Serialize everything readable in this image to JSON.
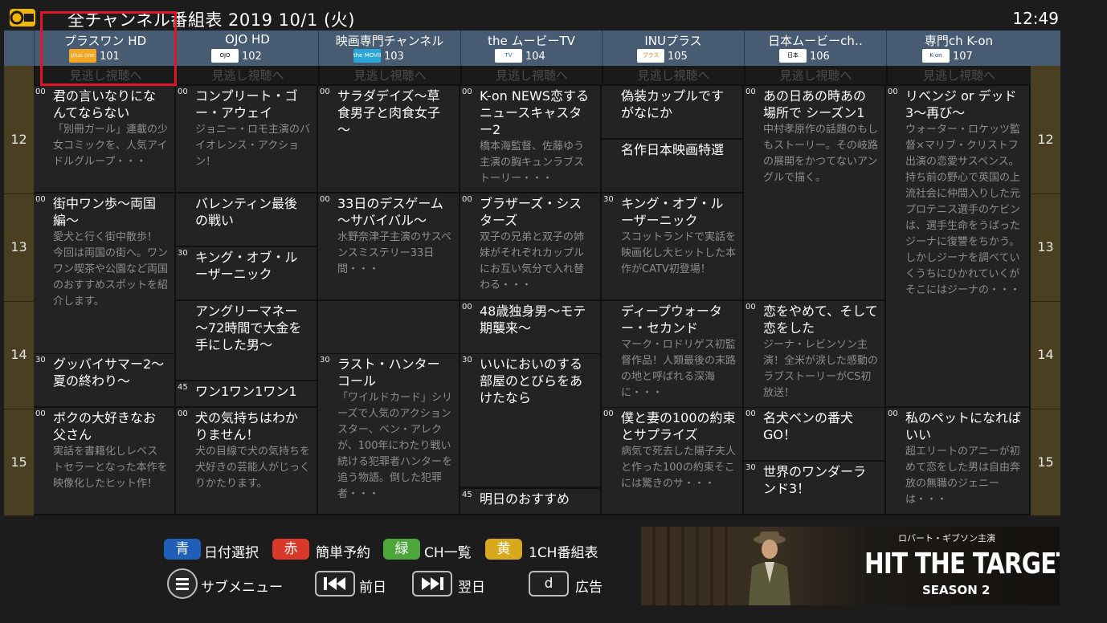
{
  "header": {
    "title": "全チャンネル番組表 2019 10/1 (火)",
    "clock": "12:49",
    "logo_text": "G GUIDE"
  },
  "missed_label": "見逃し視聴へ",
  "hours": [
    "12",
    "13",
    "14",
    "15"
  ],
  "channels": [
    {
      "name": "プラスワン HD",
      "num": "101",
      "logo": "plus one",
      "logo_bg": "#f5a623",
      "logo_fg": "#ffffff"
    },
    {
      "name": "OJO HD",
      "num": "102",
      "logo": "OJO",
      "logo_bg": "#ffffff",
      "logo_fg": "#000000"
    },
    {
      "name": "映画専門チャンネル",
      "num": "103",
      "logo": "the MOVIE",
      "logo_bg": "#2aa6d8",
      "logo_fg": "#ffffff"
    },
    {
      "name": "the ムービーTV",
      "num": "104",
      "logo": "TV",
      "logo_bg": "#ffffff",
      "logo_fg": "#1e73be"
    },
    {
      "name": "INUプラス",
      "num": "105",
      "logo": "プラス",
      "logo_bg": "#ffffff",
      "logo_fg": "#d88a1a"
    },
    {
      "name": "日本ムービーch‥",
      "num": "106",
      "logo": "日本",
      "logo_bg": "#ffffff",
      "logo_fg": "#000000"
    },
    {
      "name": "専門ch K-on",
      "num": "107",
      "logo": "K-on",
      "logo_bg": "#ffffff",
      "logo_fg": "#1e3f8f"
    }
  ],
  "programs": [
    [
      {
        "min": "00",
        "title": "君の言いなりになんてならない",
        "desc": "「別冊ガール」連載の少女コミックを、人気アイドルグループ・・・",
        "start": 0,
        "dur": 60
      },
      {
        "min": "00",
        "title": "街中ワン歩～両国編～",
        "desc": "愛犬と行く街中散歩！\n今回は両国の街へ。ワンワン喫茶や公園など両国のおすすめスポットを紹介します。",
        "start": 60,
        "dur": 90
      },
      {
        "min": "30",
        "title": "グッバイサマー2～夏の終わり～",
        "desc": "",
        "start": 150,
        "dur": 30
      },
      {
        "min": "00",
        "title": "ボクの大好きなお父さん",
        "desc": "実話を書籍化しレベストセラーとなった本作を映像化したヒット作！",
        "start": 180,
        "dur": 60
      }
    ],
    [
      {
        "min": "00",
        "title": "コンプリート・ゴー・アウェイ",
        "desc": "ジョニー・ロモ主演のバイオレンス・アクション！",
        "start": 0,
        "dur": 60
      },
      {
        "min": "",
        "title": "バレンティン最後の戦い",
        "desc": "",
        "start": 60,
        "dur": 30
      },
      {
        "min": "30",
        "title": "キング・オブ・ルーザーニック",
        "desc": "",
        "start": 90,
        "dur": 30
      },
      {
        "min": "",
        "title": "アングリーマネー～72時間で大金を手にした男～",
        "desc": "",
        "start": 120,
        "dur": 45
      },
      {
        "min": "45",
        "title": "ワン1ワン1ワン1",
        "desc": "",
        "start": 165,
        "dur": 15
      },
      {
        "min": "00",
        "title": "犬の気持ちはわかりません！",
        "desc": "犬の目線で犬の気持ちを犬好きの芸能人がじっくりかたります。",
        "start": 180,
        "dur": 60
      }
    ],
    [
      {
        "min": "00",
        "title": "サラダデイズ～草食男子と肉食女子～",
        "desc": "",
        "start": 0,
        "dur": 60
      },
      {
        "min": "00",
        "title": "33日のデスゲーム～サバイバル～",
        "desc": "水野奈津子主演のサスペンスミステリー33日間・・・",
        "start": 60,
        "dur": 60
      },
      {
        "min": "",
        "title": "",
        "desc": "",
        "start": 120,
        "dur": 30
      },
      {
        "min": "30",
        "title": "ラスト・ハンターコール",
        "desc": "「ワイルドカード」シリーズで人気のアクションスター、ベン・アレクが、100年にわたり戦い続ける犯罪者ハンターを追う物語。倒した犯罪者・・・",
        "start": 150,
        "dur": 90
      }
    ],
    [
      {
        "min": "00",
        "title": "K-on NEWS恋するニュースキャスター2",
        "desc": "橋本海監督、佐藤ゆう主演の胸キュンラブストーリー・・・",
        "start": 0,
        "dur": 60
      },
      {
        "min": "00",
        "title": "ブラザーズ・シスターズ",
        "desc": "双子の兄弟と双子の姉妹がそれぞれカップルにお互い気分で入れ替わる・・・",
        "start": 60,
        "dur": 60
      },
      {
        "min": "00",
        "title": "48歳独身男～モテ期襲来～",
        "desc": "",
        "start": 120,
        "dur": 30
      },
      {
        "min": "30",
        "title": "いいにおいのする部屋のとびらをあけたなら",
        "desc": "",
        "start": 150,
        "dur": 75
      },
      {
        "min": "45",
        "title": "明日のおすすめ",
        "desc": "",
        "start": 225,
        "dur": 15
      }
    ],
    [
      {
        "min": "",
        "title": "偽装カップルですがなにか",
        "desc": "",
        "start": 0,
        "dur": 30
      },
      {
        "min": "",
        "title": "名作日本映画特選",
        "desc": "",
        "start": 30,
        "dur": 30
      },
      {
        "min": "30",
        "title": "キング・オブ・ルーザーニック",
        "desc": "スコットランドで実話を映画化し大ヒットした本作がCATV初登場！",
        "start": 60,
        "dur": 60
      },
      {
        "min": "",
        "title": "ディープウォーター・セカンド",
        "desc": "マーク・ロドリゲス初監督作品！人類最後の末路の地と呼ばれる深海に・・・",
        "start": 120,
        "dur": 60
      },
      {
        "min": "00",
        "title": "僕と妻の100の約束とサプライズ",
        "desc": "病気で死去した陽子夫人と作った100の約束そこには驚きのサ・・・",
        "start": 180,
        "dur": 60
      }
    ],
    [
      {
        "min": "00",
        "title": "あの日あの時あの場所で シーズン1",
        "desc": "中村孝原作の話題のもしもストーリー。その岐路の展開をかつてないアングルで描く。",
        "start": 0,
        "dur": 120
      },
      {
        "min": "00",
        "title": "恋をやめて、そして恋をした",
        "desc": "ジーナ・レビンソン主演！全米が涙した感動のラブストーリーがCS初放送！",
        "start": 120,
        "dur": 60
      },
      {
        "min": "00",
        "title": "名犬ベンの番犬GO！",
        "desc": "",
        "start": 180,
        "dur": 30
      },
      {
        "min": "30",
        "title": "世界のワンダーランド3！",
        "desc": "",
        "start": 210,
        "dur": 30
      }
    ],
    [
      {
        "min": "00",
        "title": "リベンジ or デッド3～再び～",
        "desc": "ウォーター・ロケッツ監督×マリブ・クリストフ出演の恋愛サスペンス。持ち前の野心で英国の上流社会に仲間入りした元プロテニス選手のケビンは、選手生命をうばったジーナに復讐をちかう。しかしジーナを調べていくうちにひかれていくがそこにはジーナの・・・",
        "start": 0,
        "dur": 180
      },
      {
        "min": "00",
        "title": "私のペットになればいい",
        "desc": "超エリートのアニーが初めて恋をした男は自由奔放の無職のジェニーは・・・",
        "start": 180,
        "dur": 60
      }
    ]
  ],
  "footer": {
    "keys": [
      {
        "key": "青",
        "label": "日付選択",
        "color": "#1f5fb7"
      },
      {
        "key": "赤",
        "label": "簡単予約",
        "color": "#d8392b"
      },
      {
        "key": "緑",
        "label": "CH一覧",
        "color": "#4ca63a"
      },
      {
        "key": "黄",
        "label": "1CH番組表",
        "color": "#d8a91f"
      }
    ],
    "submenu_label": "サブメニュー",
    "prev_label": "前日",
    "next_label": "翌日",
    "d_key": "d",
    "ad_label": "広告"
  },
  "ad": {
    "tagline": "ロバート・ギブソン主演",
    "title": "HIT THE TARGET",
    "season": "SEASON 2"
  }
}
